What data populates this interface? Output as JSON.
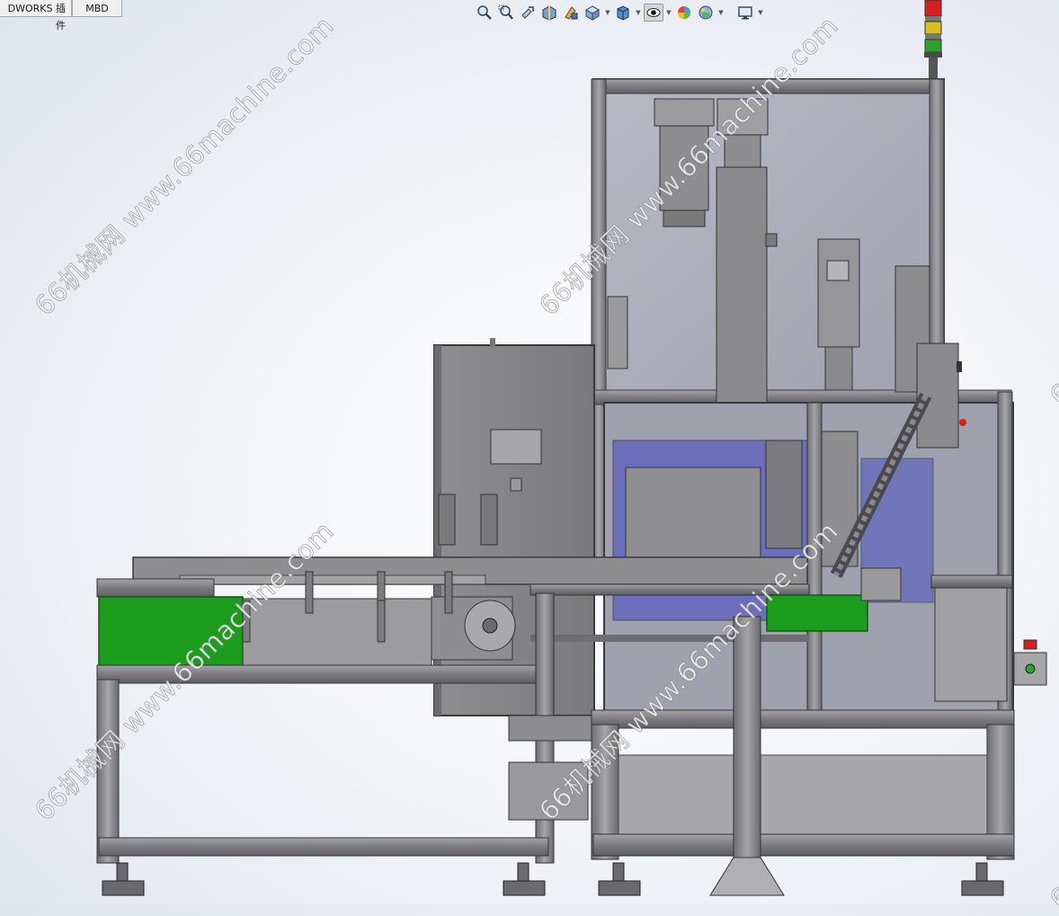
{
  "tabs": [
    {
      "label": "DWORKS 插件"
    },
    {
      "label": "MBD"
    }
  ],
  "heads_up_toolbar": [
    {
      "icon": "zoom-to-fit-icon"
    },
    {
      "icon": "zoom-to-area-icon"
    },
    {
      "icon": "previous-view-icon"
    },
    {
      "icon": "section-view-icon"
    },
    {
      "icon": "dynamic-annotation-views-icon"
    },
    {
      "icon": "view-orientation-icon"
    },
    {
      "icon": "display-style-icon"
    },
    {
      "icon": "hide-show-items-icon"
    },
    {
      "icon": "edit-appearance-icon"
    },
    {
      "icon": "apply-scene-icon"
    },
    {
      "icon": "view-settings-icon"
    }
  ],
  "watermark": {
    "text": "66机械网 www.66machine.com"
  },
  "colors": {
    "frame": "#8a8a8d",
    "frame_dark": "#5c5c5f",
    "glass": "#a7aab8",
    "guard_green": "#1c9c1c",
    "blue_plate": "#5a5fc0",
    "signal_red": "#d42020",
    "signal_yellow": "#d8c020",
    "signal_green": "#2ea02e"
  }
}
